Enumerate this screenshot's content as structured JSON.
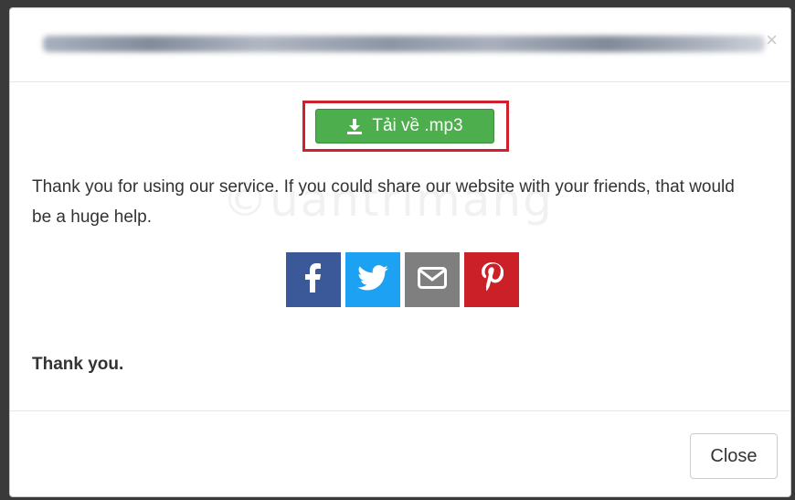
{
  "header": {
    "title_blurred": true,
    "close_glyph": "×",
    "close_icon": "close-icon"
  },
  "body": {
    "download_button": {
      "label": "Tải về .mp3",
      "icon": "download-icon",
      "color": "#4cae4c",
      "highlight_color": "#d0202c"
    },
    "message": "Thank you for using our service. If you could share our website with your friends, that would be a huge help.",
    "watermark": "©uantrimang",
    "share_buttons": [
      {
        "name": "facebook",
        "icon": "facebook-icon",
        "color": "#3b5998"
      },
      {
        "name": "twitter",
        "icon": "twitter-icon",
        "color": "#1da1f2"
      },
      {
        "name": "email",
        "icon": "email-icon",
        "color": "#7f7f7f"
      },
      {
        "name": "pinterest",
        "icon": "pinterest-icon",
        "color": "#cb2027"
      }
    ],
    "thanks": "Thank you."
  },
  "footer": {
    "close_label": "Close"
  }
}
